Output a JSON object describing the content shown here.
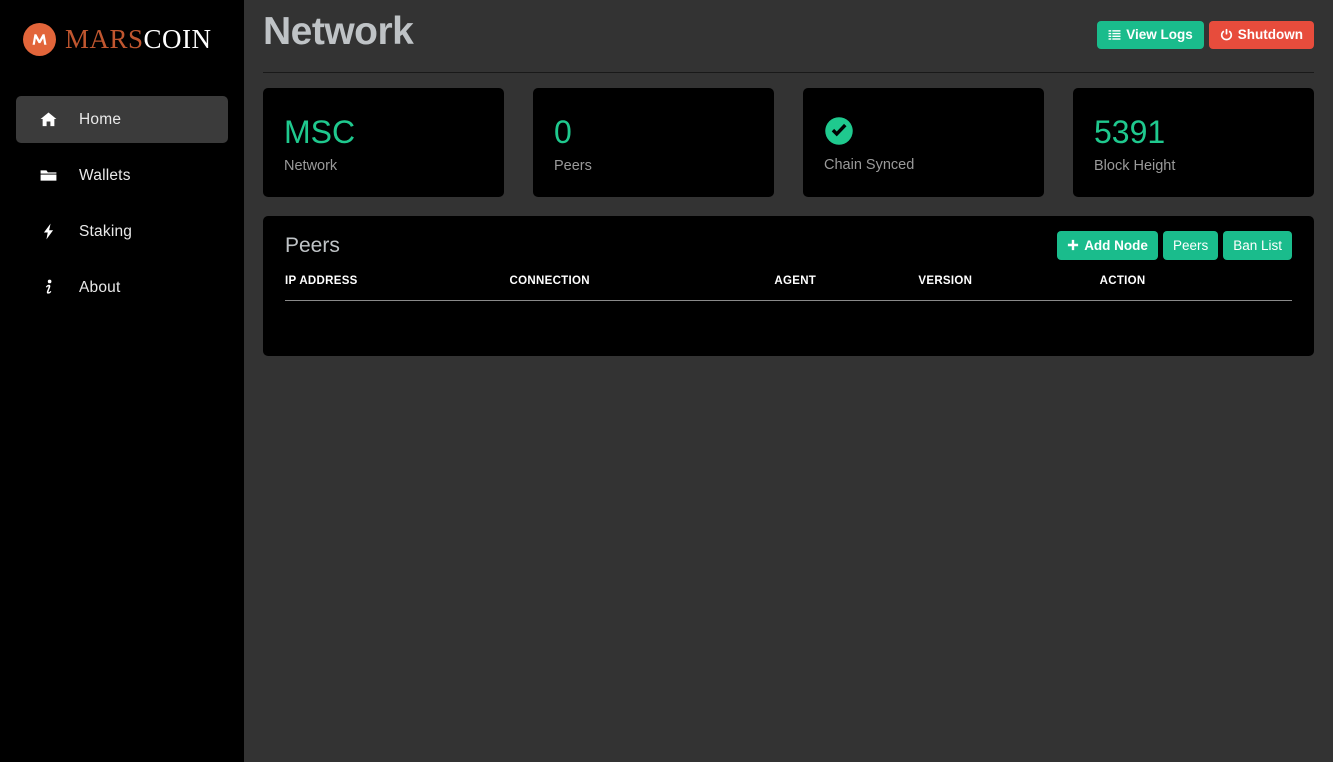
{
  "brand": {
    "badge_letter": "M",
    "name_part1": "MARS",
    "name_part2": "COIN",
    "badge_color": "#e2653a",
    "part1_color": "#c0562f",
    "part2_color": "#ffffff"
  },
  "sidebar": {
    "items": [
      {
        "label": "Home",
        "icon": "home-icon",
        "active": true
      },
      {
        "label": "Wallets",
        "icon": "folder-icon",
        "active": false
      },
      {
        "label": "Staking",
        "icon": "lightning-icon",
        "active": false
      },
      {
        "label": "About",
        "icon": "info-icon",
        "active": false
      }
    ]
  },
  "header": {
    "title": "Network",
    "view_logs_label": "View Logs",
    "shutdown_label": "Shutdown",
    "view_logs_color": "#1abc8c",
    "shutdown_color": "#e74c3c"
  },
  "stats": {
    "accent_color": "#1fc98e",
    "cards": [
      {
        "value": "MSC",
        "label": "Network",
        "type": "text"
      },
      {
        "value": "0",
        "label": "Peers",
        "type": "text"
      },
      {
        "value": "",
        "label": "Chain Synced",
        "type": "check"
      },
      {
        "value": "5391",
        "label": "Block Height",
        "type": "text"
      }
    ]
  },
  "peers_panel": {
    "title": "Peers",
    "add_node_label": "Add Node",
    "peers_label": "Peers",
    "ban_list_label": "Ban List",
    "columns": [
      "IP ADDRESS",
      "CONNECTION",
      "AGENT",
      "VERSION",
      "ACTION"
    ],
    "rows": []
  }
}
